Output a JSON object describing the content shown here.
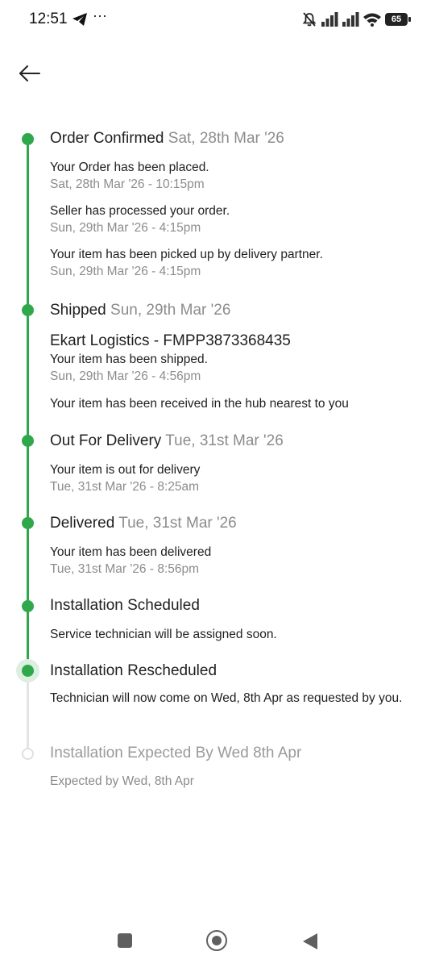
{
  "status_bar": {
    "time": "12:51",
    "more": "···",
    "battery": "65",
    "icons": [
      "telegram-icon",
      "more-dots-icon",
      "mute-icon",
      "signal-icon",
      "signal-icon",
      "wifi-icon",
      "battery-icon"
    ]
  },
  "header": {
    "back_icon": "back-arrow-icon"
  },
  "colors": {
    "accent_green": "#2ea84a",
    "muted_text": "#8c8c8c",
    "pending_line": "#e4e4e4"
  },
  "timeline": {
    "order_confirmed": {
      "title": "Order Confirmed",
      "date": "Sat, 28th Mar '26",
      "events": [
        {
          "text": "Your Order has been placed.",
          "time": "Sat, 28th Mar '26 - 10:15pm"
        },
        {
          "text": "Seller has processed your order.",
          "time": "Sun, 29th Mar '26 - 4:15pm"
        },
        {
          "text": "Your item has been picked up by delivery partner.",
          "time": "Sun, 29th Mar '26 - 4:15pm"
        }
      ]
    },
    "shipped": {
      "title": "Shipped",
      "date": "Sun, 29th Mar '26",
      "tracking": "Ekart Logistics - FMPP3873368435",
      "events": [
        {
          "text": "Your item has been shipped.",
          "time": "Sun, 29th Mar '26 - 4:56pm"
        },
        {
          "text": "Your item has been received in the hub nearest to you"
        }
      ]
    },
    "out_for_delivery": {
      "title": "Out For Delivery",
      "date": "Tue, 31st Mar '26",
      "events": [
        {
          "text": "Your item is out for delivery",
          "time": "Tue, 31st Mar '26 - 8:25am"
        }
      ]
    },
    "delivered": {
      "title": "Delivered",
      "date": "Tue, 31st Mar '26",
      "events": [
        {
          "text": "Your item has been delivered",
          "time": "Tue, 31st Mar '26 - 8:56pm"
        }
      ]
    },
    "installation_scheduled": {
      "title": "Installation Scheduled",
      "events": [
        {
          "text": "Service technician will be assigned soon."
        }
      ]
    },
    "installation_rescheduled": {
      "title": "Installation Rescheduled",
      "events": [
        {
          "text": "Technician will now come on Wed, 8th Apr as requested by you."
        }
      ]
    },
    "installation_expected": {
      "title": "Installation Expected By Wed 8th Apr",
      "events": [
        {
          "text": "Expected by Wed, 8th Apr"
        }
      ]
    }
  },
  "nav_bar": {
    "icons": [
      "recents-square-icon",
      "home-circle-icon",
      "back-triangle-icon"
    ]
  }
}
